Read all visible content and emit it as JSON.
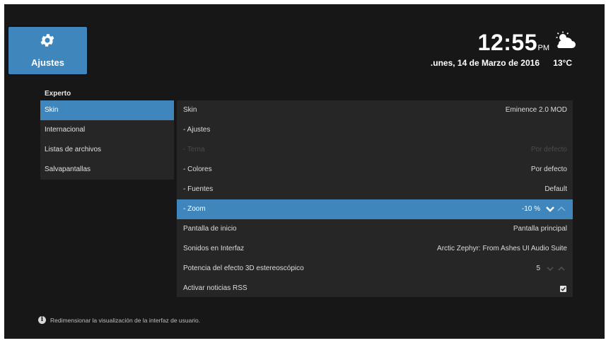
{
  "header": {
    "tile_title": "Ajustes",
    "time": "12:55",
    "ampm": "PM",
    "date": ".unes, 14 de Marzo de 2016",
    "temperature": "13°C",
    "weather_icon": "partly-cloudy-icon"
  },
  "section_title": "Experto",
  "categories": [
    {
      "label": "Skin",
      "selected": true
    },
    {
      "label": "Internacional"
    },
    {
      "label": "Listas de archivos"
    },
    {
      "label": "Salvapantallas"
    }
  ],
  "settings": [
    {
      "label": "Skin",
      "value": "Eminence 2.0 MOD"
    },
    {
      "label": "- Ajustes",
      "value": ""
    },
    {
      "label": "- Tema",
      "value": "Por defecto",
      "disabled": true
    },
    {
      "label": "- Colores",
      "value": "Por defecto"
    },
    {
      "label": "- Fuentes",
      "value": "Default"
    },
    {
      "label": "- Zoom",
      "value": "-10 %",
      "selected": true
    },
    {
      "label": "Pantalla de inicio",
      "value": "Pantalla principal"
    },
    {
      "label": "Sonidos en Interfaz",
      "value": "Arctic Zephyr: From Ashes UI Audio Suite"
    },
    {
      "label": "Potencia del efecto 3D estereoscópico",
      "value": "5"
    },
    {
      "label": "Activar noticias RSS",
      "value": "",
      "checked": true
    }
  ],
  "info_text": "Redimensionar la visualización de la interfaz de usuario.",
  "colors": {
    "accent": "#3f86bd",
    "background": "#171717",
    "panel": "#262626"
  }
}
